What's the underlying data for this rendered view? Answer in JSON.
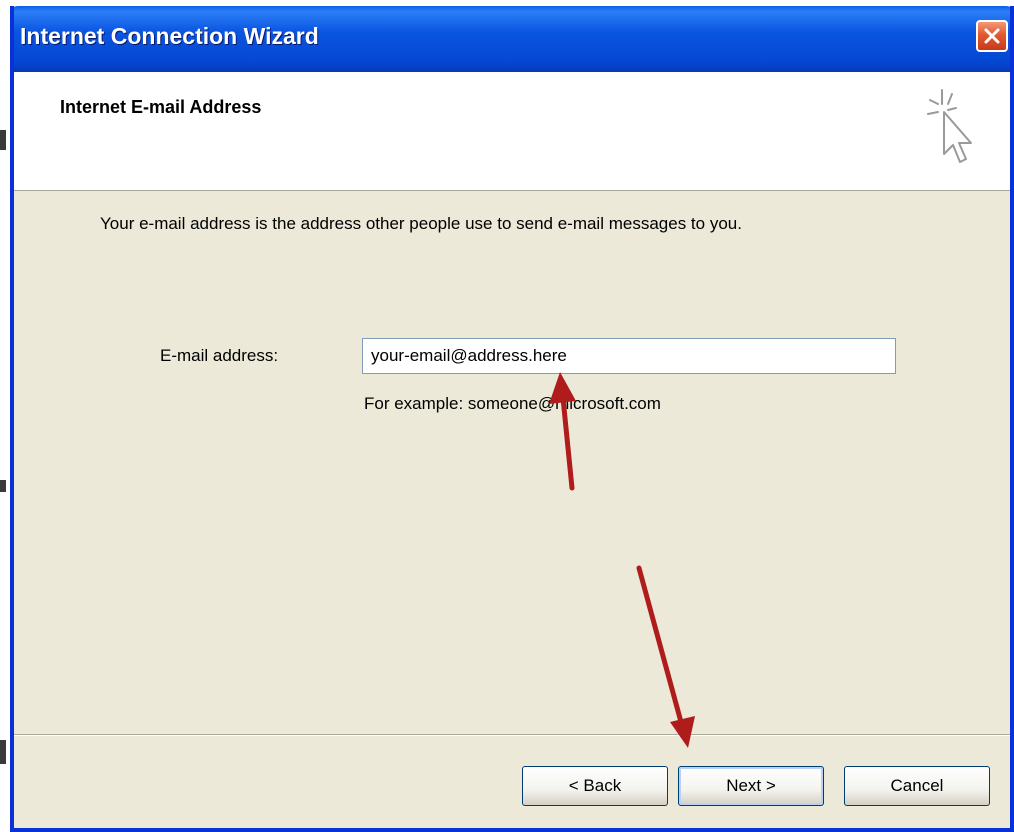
{
  "window": {
    "title": "Internet Connection Wizard",
    "close_icon": "close-icon"
  },
  "header": {
    "title": "Internet E-mail Address",
    "icon": "wizard-cursor-icon"
  },
  "body": {
    "instruction": "Your e-mail address is the address other people use to send e-mail messages to you.",
    "email_label": "E-mail address:",
    "email_value": "your-email@address.here",
    "example": "For example: someone@microsoft.com"
  },
  "buttons": {
    "back": "< Back",
    "next": "Next >",
    "cancel": "Cancel"
  },
  "annotations": {
    "arrow_color": "#b01c1c",
    "arrows": [
      "arrow-to-email-field",
      "arrow-to-next-button"
    ]
  },
  "colors": {
    "titlebar": "#0a55e0",
    "dialog_bg": "#ece9d8",
    "close_button": "#e25a30"
  }
}
